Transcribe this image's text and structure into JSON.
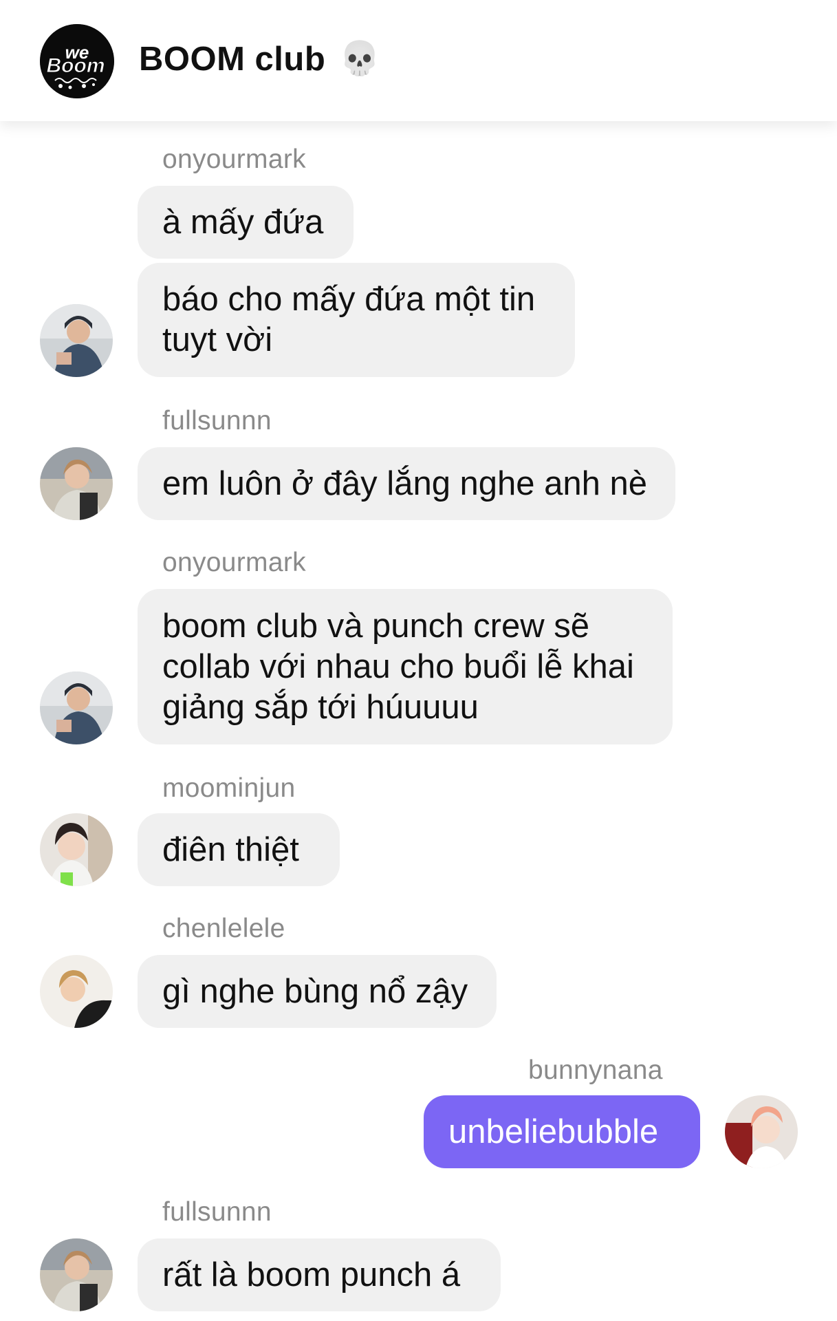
{
  "header": {
    "title": "BOOM club",
    "title_emoji": "💀",
    "logo_text": "We Boom"
  },
  "messages": [
    {
      "sender": "onyourmark",
      "bubbles": [
        "à mấy đứa",
        "báo cho mấy đứa một tin tuyt vời"
      ]
    },
    {
      "sender": "fullsunnn",
      "bubbles": [
        "em luôn ở đây lắng nghe anh nè"
      ]
    },
    {
      "sender": "onyourmark",
      "bubbles": [
        "boom club và punch crew sẽ collab với nhau cho buổi lễ khai giảng sắp tới húuuuu"
      ]
    },
    {
      "sender": "moominjun",
      "bubbles": [
        "điên thiệt"
      ]
    },
    {
      "sender": "chenlelele",
      "bubbles": [
        "gì nghe bùng nổ zậy"
      ]
    },
    {
      "sender": "bunnynana",
      "bubbles": [
        "unbeliebubble"
      ],
      "mine": true
    },
    {
      "sender": "fullsunnn",
      "bubbles": [
        "rất là boom punch á"
      ]
    }
  ],
  "colors": {
    "bubble_other": "#f0f0f0",
    "bubble_mine": "#7c66f4",
    "sender_text": "#8a8a8a"
  }
}
